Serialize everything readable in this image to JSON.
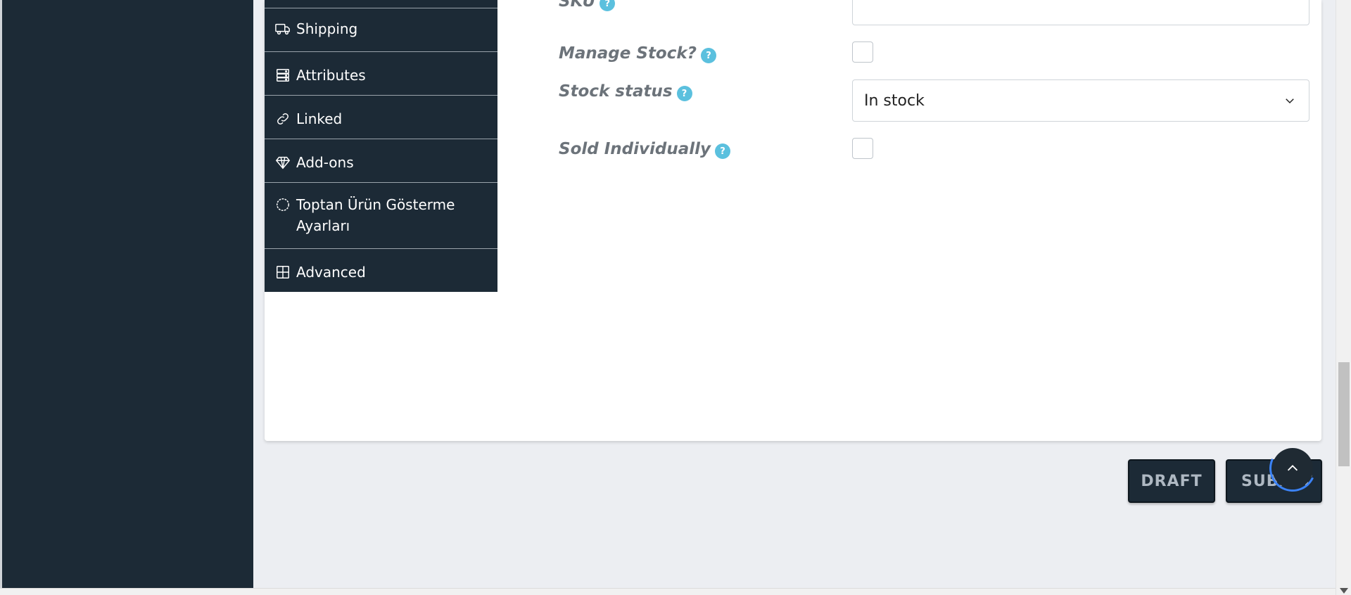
{
  "tabs": [
    {
      "label": "Shipping",
      "icon": "truck-icon"
    },
    {
      "label": "Attributes",
      "icon": "server-icon"
    },
    {
      "label": "Linked",
      "icon": "link-icon"
    },
    {
      "label": "Add-ons",
      "icon": "diamond-icon"
    },
    {
      "label": "Toptan Ürün Gösterme Ayarları",
      "icon": "circle-dashed-icon"
    },
    {
      "label": "Advanced",
      "icon": "grid-icon"
    }
  ],
  "fields": {
    "sku": {
      "label": "SKU",
      "help": "?",
      "value": ""
    },
    "manage_stock": {
      "label": "Manage Stock?",
      "help": "?",
      "checked": false
    },
    "stock_status": {
      "label": "Stock status",
      "help": "?",
      "value": "In stock"
    },
    "sold_individually": {
      "label": "Sold Individually",
      "help": "?",
      "checked": false
    }
  },
  "actions": {
    "draft": "DRAFT",
    "submit": "SUBMIT"
  },
  "colors": {
    "sidebar": "#1c2a36",
    "help_badge": "#5bc0de",
    "label": "#6c737a",
    "spinner": "#3b82f6"
  }
}
